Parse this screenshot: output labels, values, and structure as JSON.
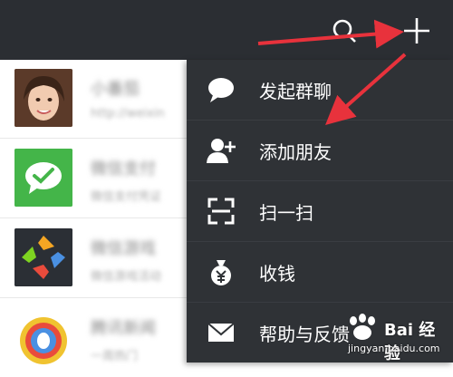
{
  "colors": {
    "topbar": "#2b2e33",
    "menu_bg": "#2f3236",
    "menu_divider": "#3a3d42",
    "arrow": "#e8323c",
    "wechat_pay_green": "#44b549"
  },
  "topbar": {
    "icons": [
      "search-icon",
      "plus-icon"
    ]
  },
  "chat_list": {
    "items": [
      {
        "name": "小番茄",
        "preview": "http://weixin",
        "avatar": "photo-avatar"
      },
      {
        "name": "微信支付",
        "preview": "微信支付凭证",
        "avatar": "wechat-pay-avatar"
      },
      {
        "name": "微信游戏",
        "preview": "微信游戏活动",
        "avatar": "wechat-game-avatar"
      },
      {
        "name": "腾讯新闻",
        "preview": "一周热门",
        "avatar": "tencent-news-avatar"
      }
    ]
  },
  "menu": {
    "items": [
      {
        "label": "发起群聊",
        "icon": "chat-bubble-icon"
      },
      {
        "label": "添加朋友",
        "icon": "add-friend-icon"
      },
      {
        "label": "扫一扫",
        "icon": "scan-icon"
      },
      {
        "label": "收钱",
        "icon": "money-bag-icon"
      },
      {
        "label": "帮助与反馈",
        "icon": "mail-icon"
      }
    ]
  },
  "watermark": {
    "text": "Bai 经验",
    "url": "jingyan.baidu.com"
  }
}
